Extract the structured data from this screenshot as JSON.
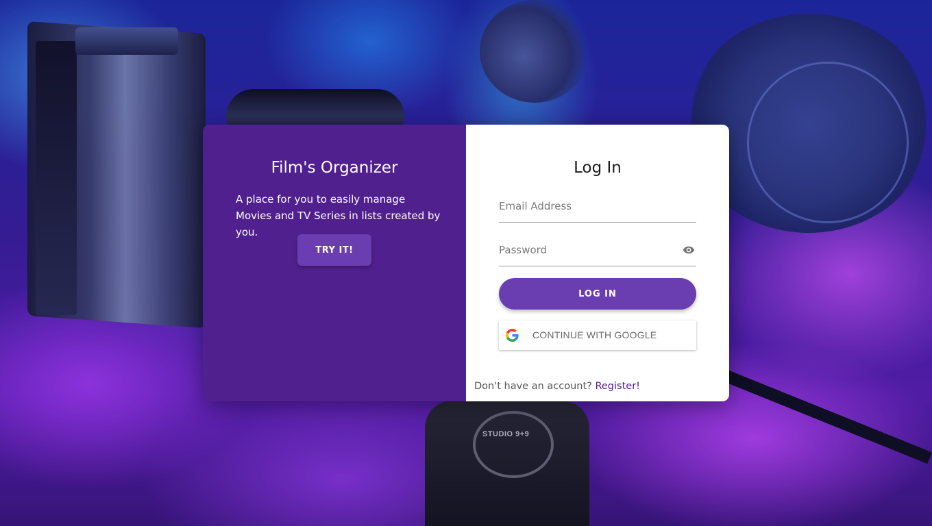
{
  "promo": {
    "title": "Film's Organizer",
    "description": "A place for you to easily manage Movies and TV Series in lists created by you.",
    "cta_label": "TRY IT!"
  },
  "login": {
    "title": "Log In",
    "email_placeholder": "Email Address",
    "email_value": "",
    "password_placeholder": "Password",
    "password_value": "",
    "password_toggle_icon": "eye-icon",
    "submit_label": "LOG IN",
    "google_label": "CONTINUE WITH GOOGLE",
    "google_icon": "google-logo-icon",
    "register_prompt": "Don't have an account?",
    "register_link": "Register!"
  },
  "background": {
    "studio_label": "STUDIO 9+9"
  },
  "colors": {
    "primary_dark": "#51208f",
    "primary_button": "#6a3db0",
    "card_right_bg": "#ffffff"
  }
}
